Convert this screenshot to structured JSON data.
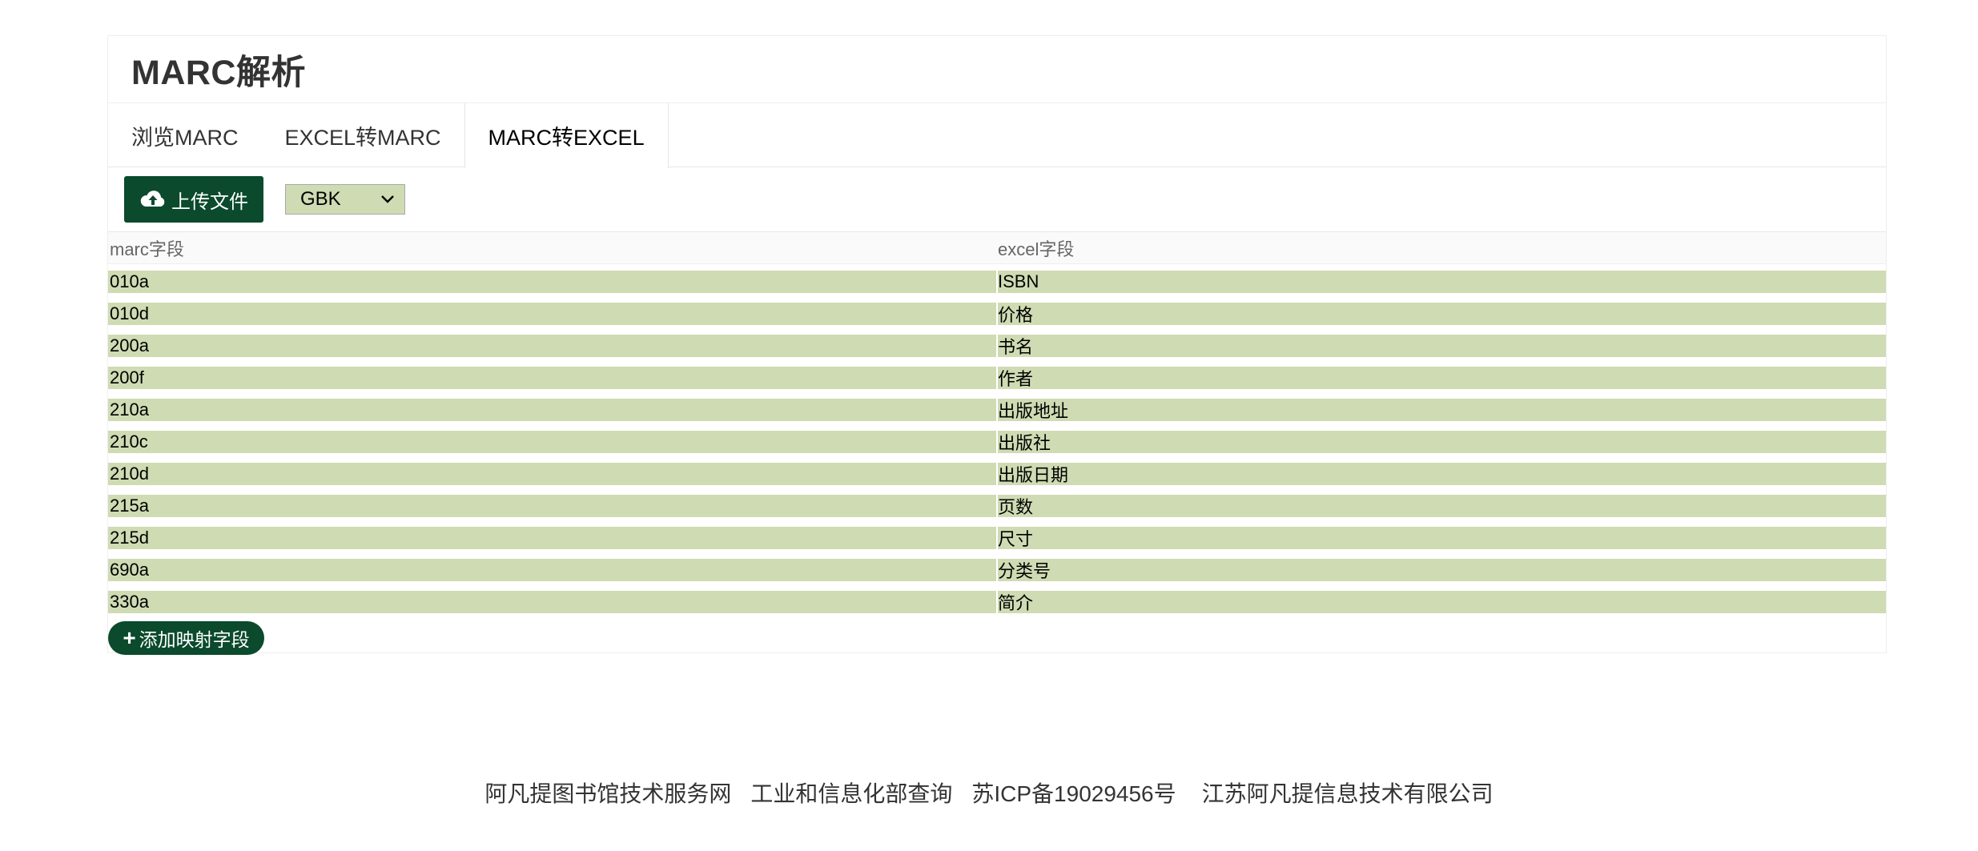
{
  "header": {
    "title": "MARC解析"
  },
  "tabs": [
    {
      "label": "浏览MARC",
      "active": false
    },
    {
      "label": "EXCEL转MARC",
      "active": false
    },
    {
      "label": "MARC转EXCEL",
      "active": true
    }
  ],
  "toolbar": {
    "upload_label": "上传文件",
    "upload_icon": "cloud-upload-icon",
    "encoding": "GBK",
    "accent_color": "#0b4a2c",
    "field_bg_color": "#cfdbb3"
  },
  "table": {
    "columns": [
      "marc字段",
      "excel字段"
    ],
    "rows": [
      {
        "marc": "010a",
        "excel": "ISBN"
      },
      {
        "marc": "010d",
        "excel": "价格"
      },
      {
        "marc": "200a",
        "excel": "书名"
      },
      {
        "marc": "200f",
        "excel": "作者"
      },
      {
        "marc": "210a",
        "excel": "出版地址"
      },
      {
        "marc": "210c",
        "excel": "出版社"
      },
      {
        "marc": "210d",
        "excel": "出版日期"
      },
      {
        "marc": "215a",
        "excel": "页数"
      },
      {
        "marc": "215d",
        "excel": "尺寸"
      },
      {
        "marc": "690a",
        "excel": "分类号"
      },
      {
        "marc": "330a",
        "excel": "简介"
      }
    ]
  },
  "add_mapping_label": "添加映射字段",
  "footer": {
    "links": [
      "阿凡提图书馆技术服务网",
      "工业和信息化部查询",
      "苏ICP备19029456号",
      "江苏阿凡提信息技术有限公司"
    ]
  }
}
